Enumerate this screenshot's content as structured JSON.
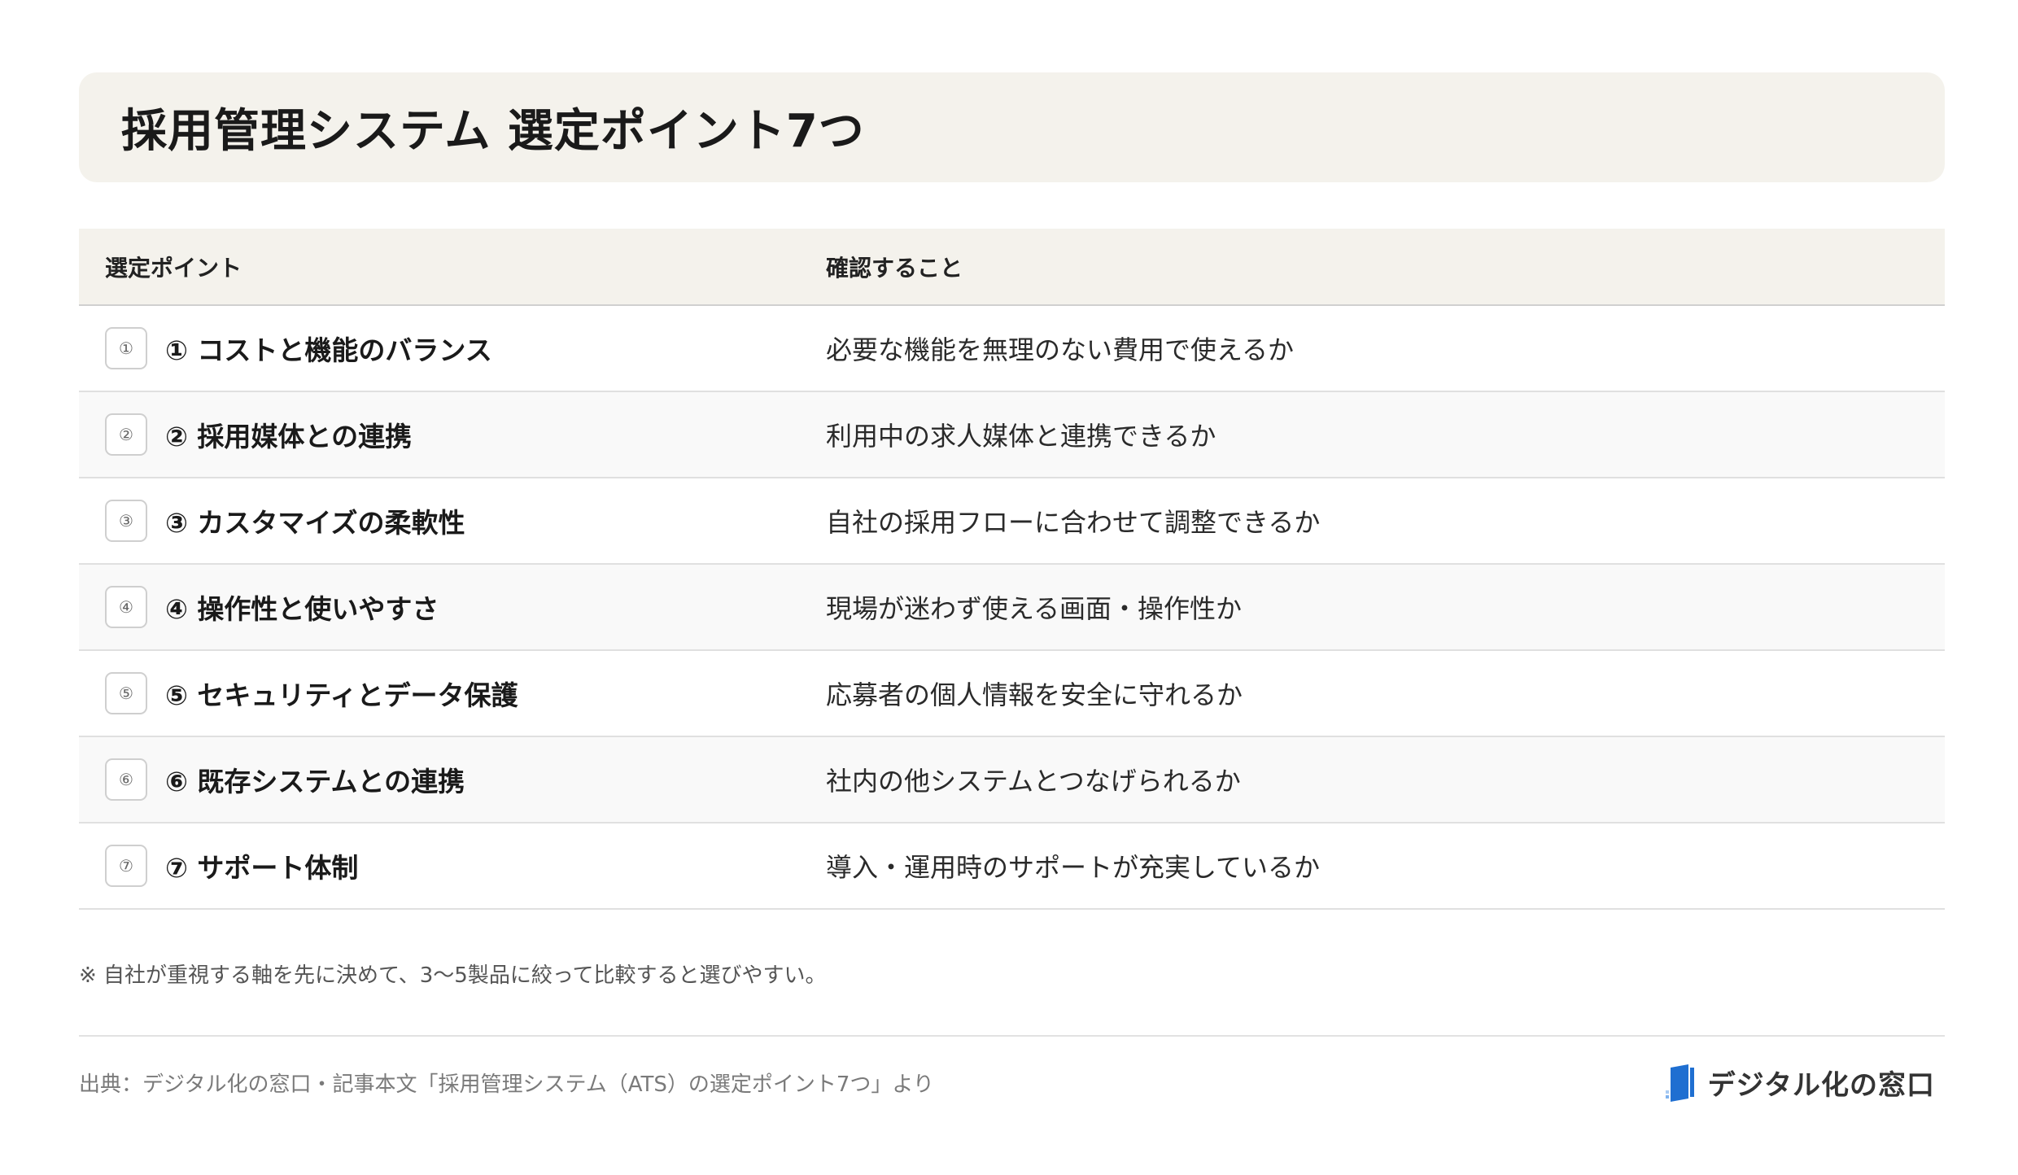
{
  "title": "採用管理システム 選定ポイント7つ",
  "table": {
    "headers": {
      "point": "選定ポイント",
      "check": "確認すること"
    },
    "rows": [
      {
        "badge": "①",
        "point": "① コストと機能のバランス",
        "check": "必要な機能を無理のない費用で使えるか"
      },
      {
        "badge": "②",
        "point": "② 採用媒体との連携",
        "check": "利用中の求人媒体と連携できるか"
      },
      {
        "badge": "③",
        "point": "③ カスタマイズの柔軟性",
        "check": "自社の採用フローに合わせて調整できるか"
      },
      {
        "badge": "④",
        "point": "④ 操作性と使いやすさ",
        "check": "現場が迷わず使える画面・操作性か"
      },
      {
        "badge": "⑤",
        "point": "⑤ セキュリティとデータ保護",
        "check": "応募者の個人情報を安全に守れるか"
      },
      {
        "badge": "⑥",
        "point": "⑥ 既存システムとの連携",
        "check": "社内の他システムとつなげられるか"
      },
      {
        "badge": "⑦",
        "point": "⑦ サポート体制",
        "check": "導入・運用時のサポートが充実しているか"
      }
    ]
  },
  "note": "※ 自社が重視する軸を先に決めて、3〜5製品に絞って比較すると選びやすい。",
  "source": "出典：デジタル化の窓口・記事本文「採用管理システム（ATS）の選定ポイント7つ」より",
  "brand": {
    "name": "デジタル化の窓口",
    "logo_icon": "book-door-icon",
    "accent": "#1f6fd1"
  }
}
